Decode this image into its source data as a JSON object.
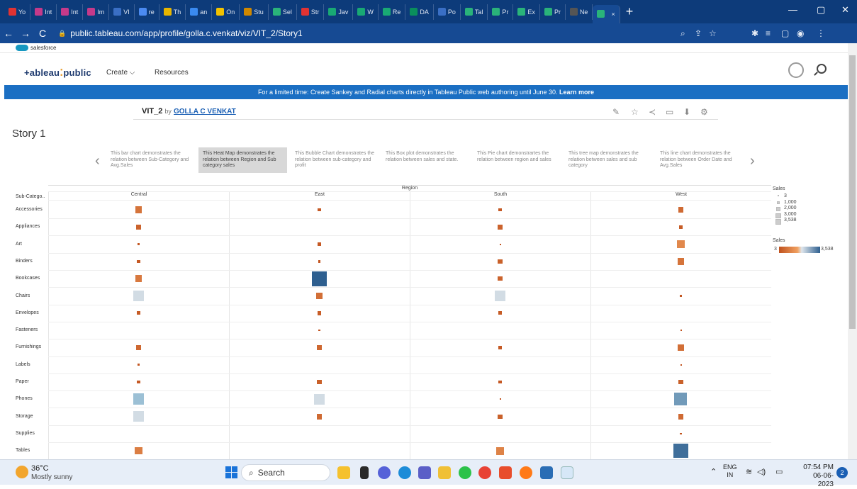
{
  "browser": {
    "tabs": [
      "Yo",
      "Int",
      "Int",
      "Im",
      "VI",
      "re",
      "Th",
      "an",
      "On",
      "Stu",
      "Sel",
      "Str",
      "Jav",
      "W",
      "Re",
      "DA",
      "Po",
      "Tal",
      "Pr",
      "Ex",
      "Pr",
      "Ne"
    ],
    "active_tab_close": "×",
    "new_tab": "+",
    "url": "public.tableau.com/app/profile/golla.c.venkat/viz/VIT_2/Story1",
    "bookmark": "salesforce"
  },
  "tableau": {
    "logo": "+ableau",
    "logo_suffix": "public",
    "nav_create": "Create ⌵",
    "nav_resources": "Resources",
    "banner_text": "For a limited time: Create Sankey and Radial charts directly in Tableau Public web authoring until June 30.",
    "banner_link": "Learn more",
    "viz_name": "VIT_2",
    "by": "by",
    "author": "GOLLA C VENKAT",
    "story_title": "Story 1"
  },
  "story_points": [
    "This bar chart demonstrates the relation between Sub-Category and Avg.Sales",
    "This Heat Map demonstrates the relation between Region and Sub category sales",
    "This Bubble Chart demonstrates the relation between sub-category and profit",
    "This Box plot demonstrates the relation between sales and state.",
    "This Pie chart demonstrartes the relation between region and sales",
    "This tree map demonstrates the relation between sales and sub category",
    "This line chart demonstrates the relation between Order Date and Avg.Sales"
  ],
  "chart_data": {
    "type": "heatmap",
    "title": "",
    "column_group": "Region",
    "row_header": "Sub-Catego..",
    "columns": [
      "Central",
      "East",
      "South",
      "West"
    ],
    "rows": [
      "Accessories",
      "Appliances",
      "Art",
      "Binders",
      "Bookcases",
      "Chairs",
      "Envelopes",
      "Fasteners",
      "Furnishings",
      "Labels",
      "Paper",
      "Phones",
      "Storage",
      "Supplies",
      "Tables"
    ],
    "size_legend_title": "Sales",
    "size_legend": [
      "3",
      "1,000",
      "2,000",
      "3,000",
      "3,538"
    ],
    "color_legend_title": "Sales",
    "color_range": [
      "3",
      "3,538"
    ],
    "color_low": "#c0521e",
    "color_mid": "#f0a060",
    "color_high": "#2e5f8f",
    "values": [
      [
        700,
        150,
        150,
        500
      ],
      [
        350,
        null,
        350,
        200
      ],
      [
        100,
        150,
        10,
        1100
      ],
      [
        150,
        100,
        300,
        700
      ],
      [
        800,
        3538,
        350,
        null
      ],
      [
        1600,
        600,
        1900,
        100
      ],
      [
        200,
        250,
        200,
        null
      ],
      [
        null,
        50,
        null,
        10
      ],
      [
        450,
        450,
        150,
        600
      ],
      [
        100,
        null,
        null,
        10
      ],
      [
        150,
        300,
        150,
        300
      ],
      [
        2000,
        1700,
        20,
        2600
      ],
      [
        1900,
        500,
        300,
        500
      ],
      [
        null,
        null,
        null,
        60
      ],
      [
        900,
        null,
        1000,
        3300
      ]
    ]
  },
  "taskbar": {
    "weather_temp": "36°C",
    "weather_desc": "Mostly sunny",
    "search": "Search",
    "lang": "ENG",
    "lang2": "IN",
    "time": "07:54 PM",
    "date": "06-06-2023",
    "notif": "2"
  },
  "colors": {
    "tab_bg": "#0d3b7a",
    "banner": "#1b6fc3"
  }
}
